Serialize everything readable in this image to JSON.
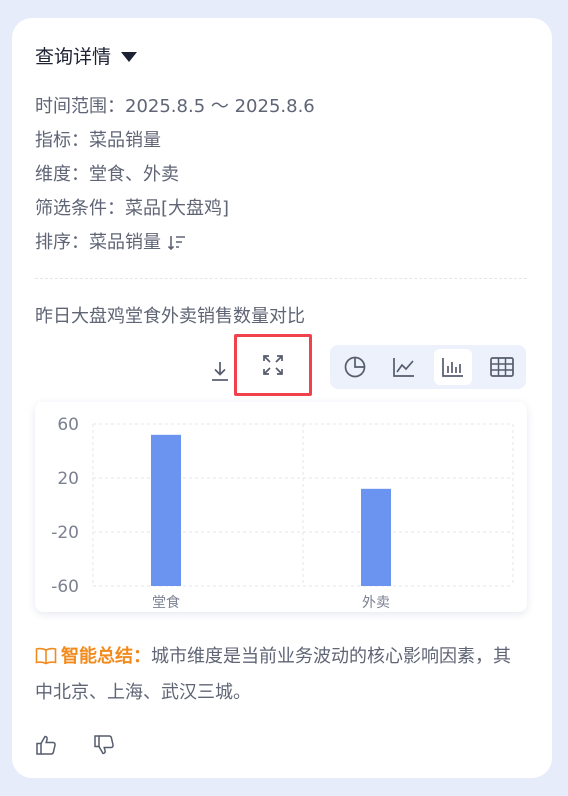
{
  "title": "查询详情",
  "info": {
    "time_range": "时间范围：2025.8.5 ～ 2025.8.6",
    "metric": "指标：菜品销量",
    "dimension": "维度：堂食、外卖",
    "filter": "筛选条件：菜品[大盘鸡]",
    "sort": "排序：菜品销量"
  },
  "chart_title": "昨日大盘鸡堂食外卖销售数量对比",
  "toolbar": {
    "icons": [
      "download-icon",
      "expand-icon",
      "pie-chart-icon",
      "line-chart-icon",
      "bar-chart-icon",
      "table-icon"
    ],
    "active_view": "bar-chart"
  },
  "chart_data": {
    "type": "bar",
    "categories": [
      "堂食",
      "外卖"
    ],
    "values": [
      52,
      12
    ],
    "yticks": [
      "60",
      "20",
      "-20",
      "-60"
    ],
    "ylim": [
      -60,
      60
    ],
    "grid": true,
    "color": "#6b93f0"
  },
  "summary": {
    "label": "智能总结：",
    "text": "城市维度是当前业务波动的核心影响因素，其中北京、上海、武汉三城。"
  },
  "colors": {
    "accent": "#6b93f0",
    "highlight_border": "#f1414d",
    "summary_label": "#f28b1e"
  }
}
